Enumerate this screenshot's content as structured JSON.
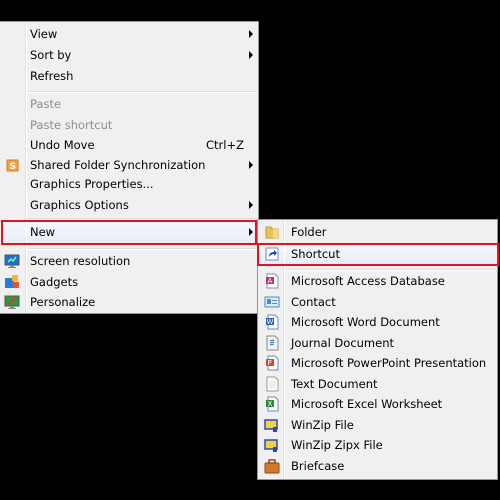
{
  "context_menu": {
    "items": [
      {
        "label": "View",
        "submenu": true
      },
      {
        "label": "Sort by",
        "submenu": true
      },
      {
        "label": "Refresh"
      },
      {
        "label": "Paste",
        "disabled": true
      },
      {
        "label": "Paste shortcut",
        "disabled": true
      },
      {
        "label": "Undo Move",
        "shortcut": "Ctrl+Z"
      },
      {
        "label": "Shared Folder Synchronization",
        "icon": "shared-folder-sync-icon",
        "submenu": true
      },
      {
        "label": "Graphics Properties..."
      },
      {
        "label": "Graphics Options",
        "submenu": true
      },
      {
        "label": "New",
        "submenu": true,
        "highlighted": true
      },
      {
        "label": "Screen resolution",
        "icon": "screen-resolution-icon"
      },
      {
        "label": "Gadgets",
        "icon": "gadgets-icon"
      },
      {
        "label": "Personalize",
        "icon": "personalize-icon"
      }
    ]
  },
  "new_submenu": {
    "items": [
      {
        "label": "Folder",
        "icon": "folder-icon"
      },
      {
        "label": "Shortcut",
        "icon": "shortcut-icon",
        "highlighted": true
      },
      {
        "label": "Microsoft Access Database",
        "icon": "access-database-icon"
      },
      {
        "label": "Contact",
        "icon": "contact-icon"
      },
      {
        "label": "Microsoft Word Document",
        "icon": "word-document-icon"
      },
      {
        "label": "Journal Document",
        "icon": "journal-document-icon"
      },
      {
        "label": "Microsoft PowerPoint Presentation",
        "icon": "powerpoint-presentation-icon"
      },
      {
        "label": "Text Document",
        "icon": "text-document-icon"
      },
      {
        "label": "Microsoft Excel Worksheet",
        "icon": "excel-worksheet-icon"
      },
      {
        "label": "WinZip File",
        "icon": "winzip-file-icon"
      },
      {
        "label": "WinZip Zipx File",
        "icon": "winzip-zipx-file-icon"
      },
      {
        "label": "Briefcase",
        "icon": "briefcase-icon"
      }
    ]
  },
  "colors": {
    "highlight_outline": "#e0141e",
    "menu_background": "#f0f0f0",
    "desktop_background": "#000000"
  }
}
